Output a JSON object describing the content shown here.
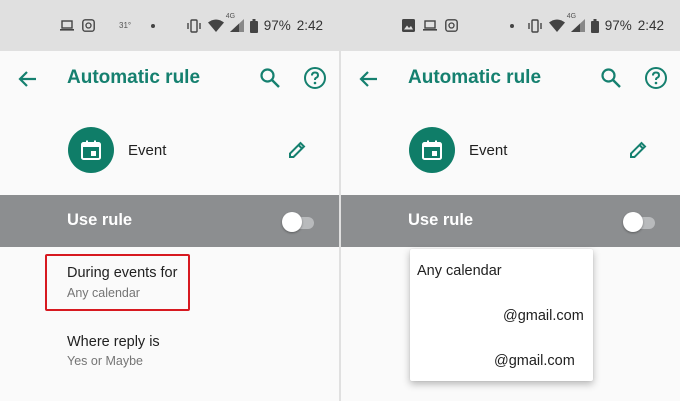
{
  "status_bar": {
    "temperature": "31°",
    "battery_percent": "97%",
    "time": "2:42",
    "network_label": "4G"
  },
  "app_bar": {
    "title": "Automatic rule",
    "back_icon": "arrow-back-icon",
    "search_icon": "search-icon",
    "help_icon": "help-circle-icon"
  },
  "rule": {
    "type_label": "Event",
    "type_icon": "calendar-icon",
    "edit_icon": "pencil-icon"
  },
  "use_rule": {
    "label": "Use rule",
    "enabled": false
  },
  "settings": [
    {
      "title": "During events for",
      "value": "Any calendar"
    },
    {
      "title": "Where reply is",
      "value": "Yes or Maybe"
    }
  ],
  "calendar_menu": {
    "options": [
      "Any calendar",
      "@gmail.com",
      "@gmail.com"
    ]
  },
  "colors": {
    "accent": "#15806f",
    "avatar": "#0f7d68",
    "use_rule_bar": "#8c8e90",
    "highlight": "#d71920",
    "status_bar": "#e0e0e0"
  }
}
